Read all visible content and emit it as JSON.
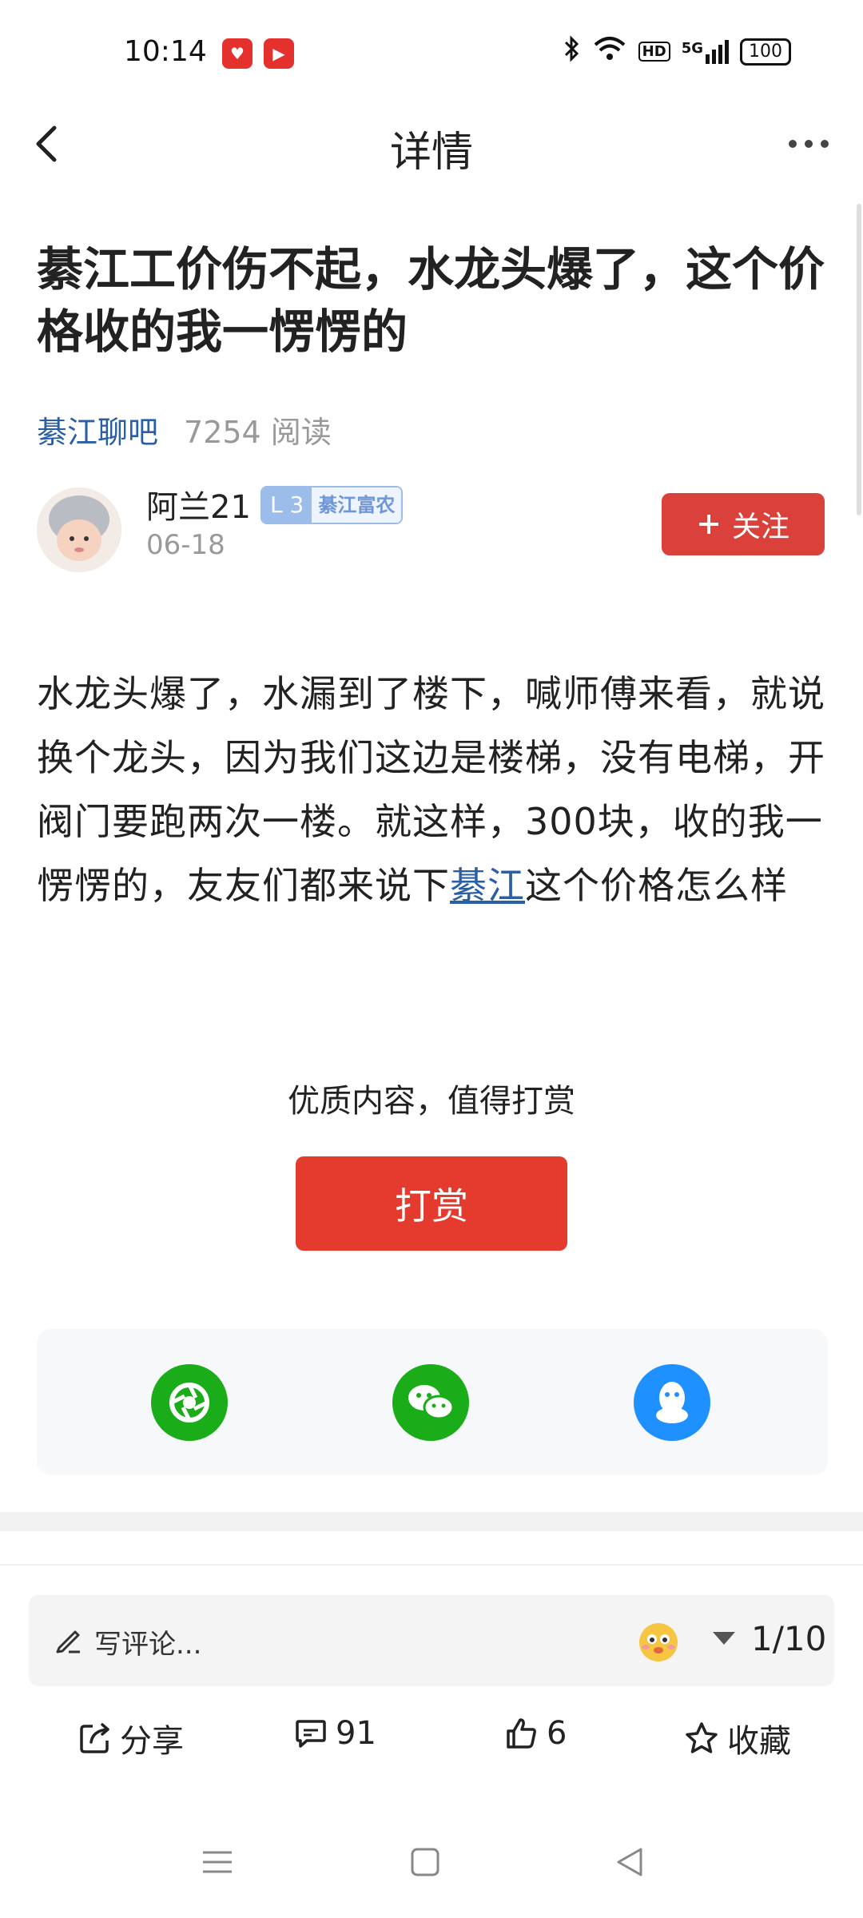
{
  "status_bar": {
    "time": "10:14",
    "network": "5G",
    "hd": "HD",
    "battery": "100"
  },
  "nav": {
    "title": "详情"
  },
  "post": {
    "title": "綦江工价伤不起，水龙头爆了，这个价格收的我一愣愣的",
    "forum": "綦江聊吧",
    "reads": "7254 阅读",
    "body_main": "水龙头爆了，水漏到了楼下，喊师傅来看，就说换个龙头，因为我们这边是楼梯，没有电梯，开阀门要跑两次一楼。就这样，300块，收的我一愣愣的，友友们都来说下",
    "body_link": "綦江",
    "body_tail": "这个价格怎么样"
  },
  "author": {
    "name": "阿兰21",
    "date": "06-18",
    "level": "L 3",
    "level_title": "綦江富农",
    "follow_label": "关注"
  },
  "reward": {
    "prompt": "优质内容，值得打赏",
    "button": "打赏"
  },
  "share_targets": [
    {
      "icon": "moments-icon",
      "color": "#1aad19"
    },
    {
      "icon": "wechat-icon",
      "color": "#1aad19"
    },
    {
      "icon": "qq-icon",
      "color": "#1e90ff"
    }
  ],
  "bottom": {
    "comment_placeholder": "写评论...",
    "page_indicator": "1/10",
    "share_label": "分享",
    "comment_count": "91",
    "like_count": "6",
    "favorite_label": "收藏"
  }
}
